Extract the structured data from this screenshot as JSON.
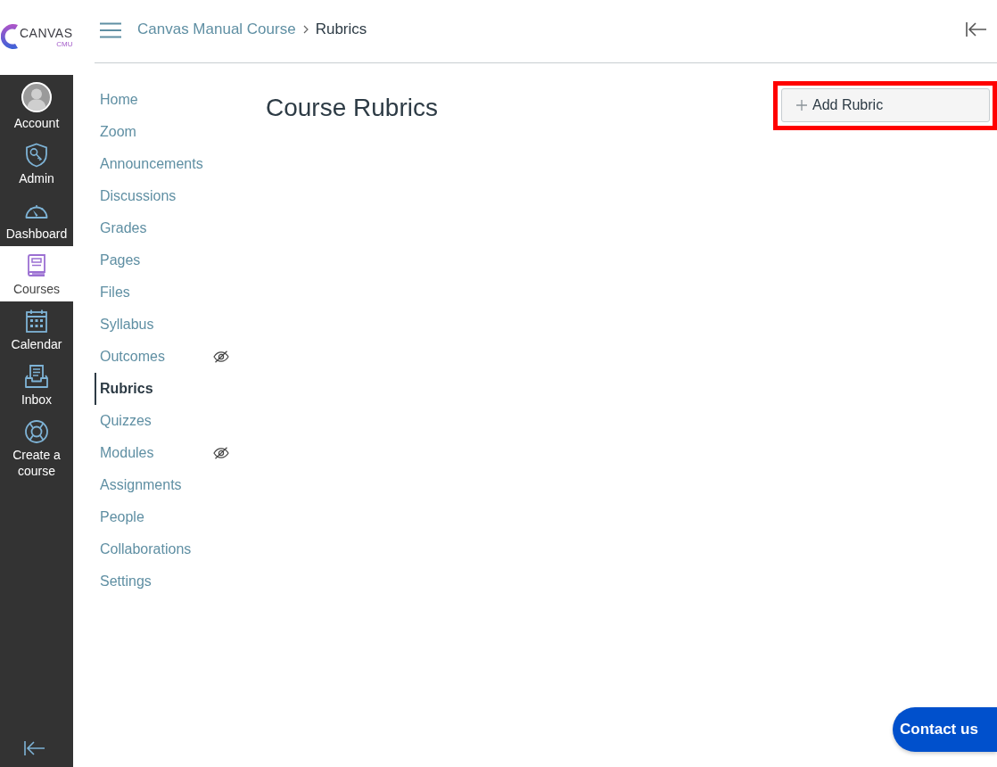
{
  "logo": {
    "wordmark": "CANVAS",
    "subtitle": "CMU"
  },
  "global_nav": {
    "items": [
      {
        "label": "Account",
        "kind": "avatar",
        "selected": false
      },
      {
        "label": "Admin",
        "kind": "shield",
        "selected": false
      },
      {
        "label": "Dashboard",
        "kind": "gauge",
        "selected": false
      },
      {
        "label": "Courses",
        "kind": "book",
        "selected": true
      },
      {
        "label": "Calendar",
        "kind": "calendar",
        "selected": false
      },
      {
        "label": "Inbox",
        "kind": "inbox",
        "selected": false
      },
      {
        "label": "Create a course",
        "kind": "lifebuoy",
        "selected": false
      }
    ]
  },
  "header": {
    "breadcrumbs": [
      {
        "label": "Canvas Manual Course",
        "kind": "link"
      },
      {
        "label": "Rubrics",
        "kind": "current"
      }
    ]
  },
  "course_nav": {
    "items": [
      {
        "label": "Home",
        "selected": false,
        "hidden": false
      },
      {
        "label": "Zoom",
        "selected": false,
        "hidden": false
      },
      {
        "label": "Announcements",
        "selected": false,
        "hidden": false
      },
      {
        "label": "Discussions",
        "selected": false,
        "hidden": false
      },
      {
        "label": "Grades",
        "selected": false,
        "hidden": false
      },
      {
        "label": "Pages",
        "selected": false,
        "hidden": false
      },
      {
        "label": "Files",
        "selected": false,
        "hidden": false
      },
      {
        "label": "Syllabus",
        "selected": false,
        "hidden": false
      },
      {
        "label": "Outcomes",
        "selected": false,
        "hidden": true
      },
      {
        "label": "Rubrics",
        "selected": true,
        "hidden": false
      },
      {
        "label": "Quizzes",
        "selected": false,
        "hidden": false
      },
      {
        "label": "Modules",
        "selected": false,
        "hidden": true
      },
      {
        "label": "Assignments",
        "selected": false,
        "hidden": false
      },
      {
        "label": "People",
        "selected": false,
        "hidden": false
      },
      {
        "label": "Collaborations",
        "selected": false,
        "hidden": false
      },
      {
        "label": "Settings",
        "selected": false,
        "hidden": false
      }
    ]
  },
  "page": {
    "title": "Course Rubrics",
    "add_button": {
      "label": "Add Rubric",
      "highlighted": true
    }
  },
  "contact_button": {
    "label": "Contact us"
  }
}
